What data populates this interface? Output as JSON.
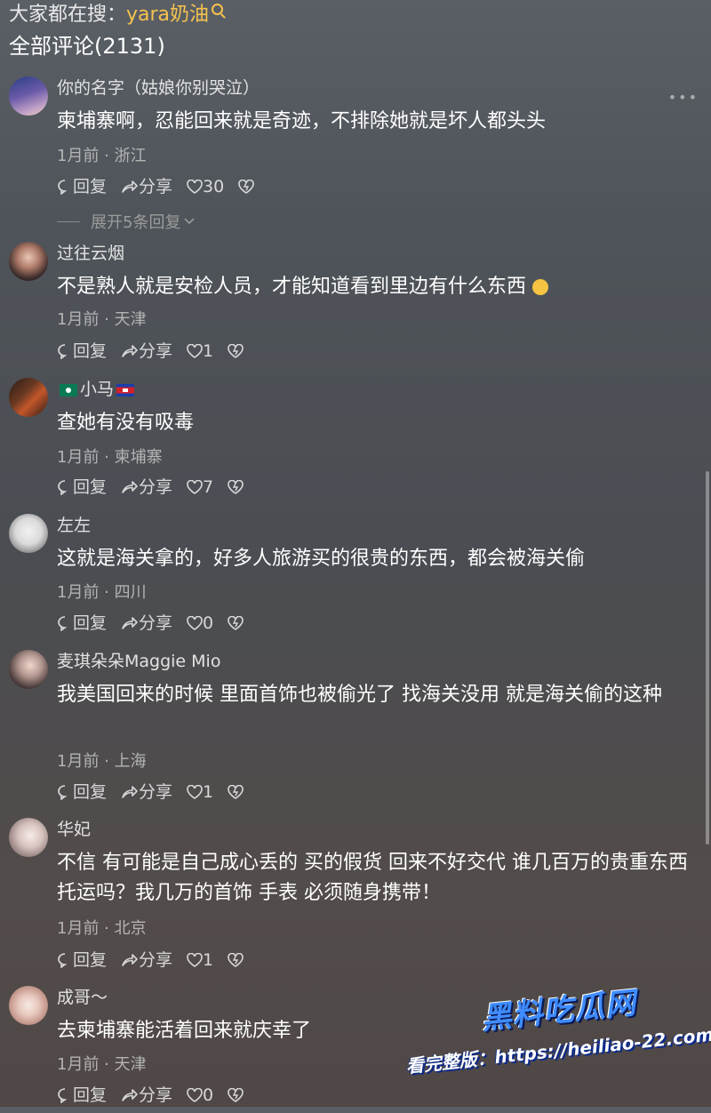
{
  "header": {
    "search_prefix": "大家都在搜：",
    "search_term": "yara奶油",
    "comment_count_label": "全部评论(2131)"
  },
  "more_icon_glyph": "•••",
  "comments": [
    {
      "username": "你的名字（姑娘你别哭泣）",
      "text": "柬埔寨啊，忍能回来就是奇迹，不排除她就是坏人都头头",
      "meta": "1月前 · 浙江",
      "reply_label": "回复",
      "share_label": "分享",
      "likes": "30",
      "expand_label": "展开5条回复"
    },
    {
      "username": "过往云烟",
      "text": "不是熟人就是安检人员，才能知道看到里边有什么东西",
      "meta": "1月前 · 天津",
      "reply_label": "回复",
      "share_label": "分享",
      "likes": "1"
    },
    {
      "username": "小马",
      "text": "查她有没有吸毒",
      "meta": "1月前 · 柬埔寨",
      "reply_label": "回复",
      "share_label": "分享",
      "likes": "7"
    },
    {
      "username": "左左",
      "text": "这就是海关拿的，好多人旅游买的很贵的东西，都会被海关偷",
      "meta": "1月前 · 四川",
      "reply_label": "回复",
      "share_label": "分享",
      "likes": "0"
    },
    {
      "username": "麦琪朵朵Maggie Mio",
      "text": "我美国回来的时候 里面首饰也被偷光了 找海关没用 就是海关偷的这种",
      "meta": "1月前 · 上海",
      "reply_label": "回复",
      "share_label": "分享",
      "likes": "1"
    },
    {
      "username": "华妃",
      "text": "不信 有可能是自己成心丢的 买的假货 回来不好交代 谁几百万的贵重东西托运吗？我几万的首饰 手表 必须随身携带！",
      "meta": "1月前 · 北京",
      "reply_label": "回复",
      "share_label": "分享",
      "likes": "1"
    },
    {
      "username": "成哥～",
      "text": "去柬埔寨能活着回来就庆幸了",
      "meta": "1月前 · 天津",
      "reply_label": "回复",
      "share_label": "分享",
      "likes": "0"
    }
  ],
  "watermark": {
    "title": "黑料吃瓜网",
    "url_line": "看完整版：https://heiliao-22.com"
  },
  "colors": {
    "search_term": "#f5c24d",
    "watermark_title": "#3f8cff"
  }
}
